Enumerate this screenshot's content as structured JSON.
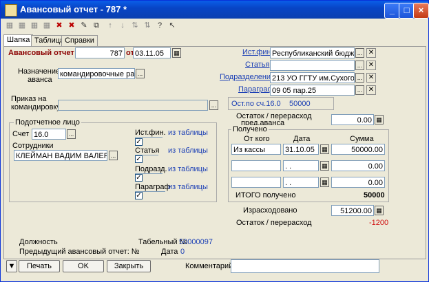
{
  "window": {
    "title": "Авансовый отчет - 787 *"
  },
  "tabs": [
    "Шапка",
    "Таблица",
    "Справки"
  ],
  "header": {
    "doc_label": "Авансовый отчет №",
    "doc_number": "787",
    "date_label": "от",
    "date": "03.11.05"
  },
  "purpose": {
    "label_1": "Назначение",
    "label_2": "аванса",
    "value": "командировочные расходы"
  },
  "order": {
    "label_1": "Приказ на",
    "label_2": "командировку:",
    "value": ""
  },
  "attrs": {
    "source_label": "Ист.фин.",
    "source_value": "Республиканский бюджет",
    "article_label": "Статья",
    "article_value": "",
    "division_label": "Подразделение",
    "division_value": "213 УО ГГТУ им.Сухого",
    "paragraph_label": "Параграф",
    "paragraph_value": "09 05 пар.25"
  },
  "balance_account": {
    "label": "Ост.по сч.16.0",
    "value": "50000"
  },
  "prev_balance": {
    "label_1": "Остаток / перерасход",
    "label_2": "пред.аванса",
    "value": "0.00"
  },
  "person": {
    "group_label": "Подотчетное лицо",
    "account_label": "Счет",
    "account_value": "16.0",
    "employees_label": "Сотрудники",
    "employee_value": "КЛЕЙМАН ВАДИМ ВАЛЕРЬЕ",
    "rows": [
      {
        "label": "Ист.фин.",
        "from": "из таблицы",
        "checked": true
      },
      {
        "label": "Статья",
        "from": "из таблицы",
        "checked": true
      },
      {
        "label": "Подразд.",
        "from": "из таблицы",
        "checked": true
      },
      {
        "label": "Параграф",
        "from": "из таблицы",
        "checked": true
      }
    ]
  },
  "received": {
    "group_label": "Получено",
    "col_from": "От кого",
    "col_date": "Дата",
    "col_sum": "Сумма",
    "rows": [
      {
        "from": "Из кассы",
        "date": "31.10.05",
        "sum": "50000.00"
      },
      {
        "from": "",
        "date": " . .",
        "sum": "0.00"
      },
      {
        "from": "",
        "date": " . .",
        "sum": "0.00"
      }
    ],
    "total_label": "ИТОГО получено",
    "total_value": "50000"
  },
  "spent": {
    "label": "Израсходовано",
    "value": "51200.00"
  },
  "remainder": {
    "label": "Остаток / перерасход",
    "value": "-1200"
  },
  "footer": {
    "position_label": "Должность",
    "tab_no_label": "Табельный №",
    "tab_no_value": "50000097",
    "prev_report_label": "Предыдущий авансовый отчет: №",
    "date_label": "Дата",
    "date_value": "0",
    "print": "Печать",
    "ok": "OK",
    "close": "Закрыть",
    "comment_label": "Комментарий",
    "comment_value": ""
  },
  "colors": {
    "title_bar": "#0a5ee8",
    "link_blue": "#1b3fb5",
    "red": "#d01010"
  }
}
